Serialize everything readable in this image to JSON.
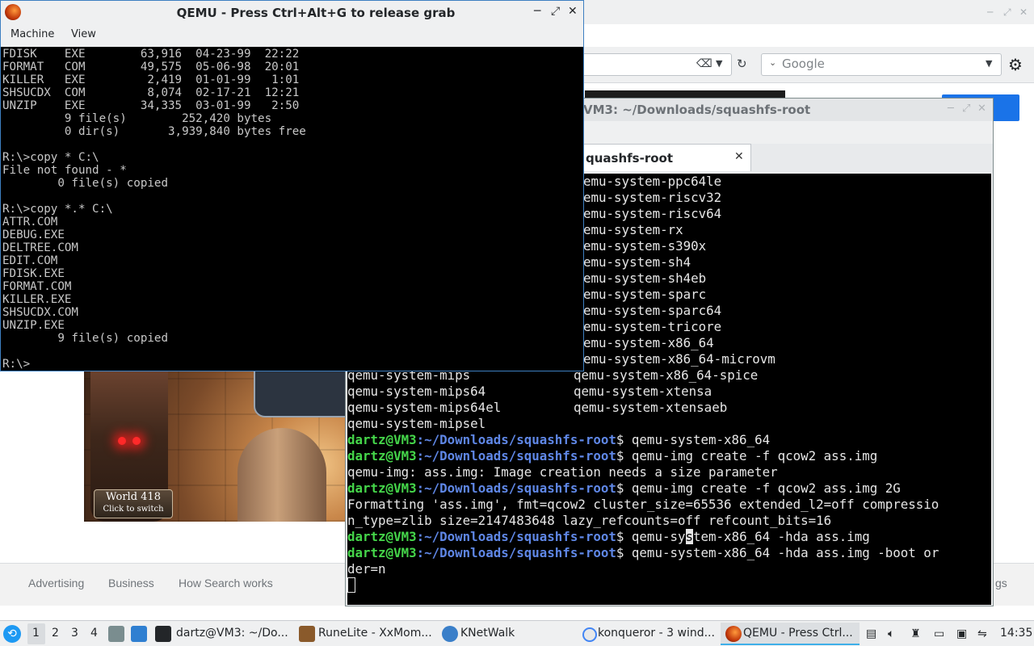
{
  "browser": {
    "search_placeholder": "Google",
    "footer_links": [
      "Advertising",
      "Business",
      "How Search works"
    ],
    "footer_right": "gs"
  },
  "game": {
    "world_title": "World 418",
    "world_sub": "Click to switch"
  },
  "konsole": {
    "title": "VM3: ~/Downloads/squashfs-root",
    "tab_label": "quashfs-root",
    "terminal_lines": [
      "emu-system-ppc64le",
      "emu-system-riscv32",
      "emu-system-riscv64",
      "emu-system-rx",
      "emu-system-s390x",
      "emu-system-sh4",
      "emu-system-sh4eb",
      "emu-system-sparc",
      "emu-system-sparc64",
      "emu-system-tricore",
      "emu-system-x86_64",
      "emu-system-x86_64-microvm"
    ],
    "terminal_columns": [
      [
        "qemu-system-mips",
        "qemu-system-x86_64-spice"
      ],
      [
        "qemu-system-mips64",
        "qemu-system-xtensa"
      ],
      [
        "qemu-system-mips64el",
        "qemu-system-xtensaeb"
      ],
      [
        "qemu-system-mipsel",
        ""
      ]
    ],
    "prompt_user": "dartz@VM3",
    "prompt_path": ":~/Downloads/squashfs-root",
    "commands": [
      "$ qemu-system-x86_64",
      "$ qemu-img create -f qcow2 ass.img"
    ],
    "output_1": "qemu-img: ass.img: Image creation needs a size parameter",
    "command_3": "$ qemu-img create -f qcow2 ass.img 2G",
    "output_2": "Formatting 'ass.img', fmt=qcow2 cluster_size=65536 extended_l2=off compressio",
    "output_3": "n_type=zlib size=2147483648 lazy_refcounts=off refcount_bits=16",
    "command_4_pre": "$ qemu-sy",
    "command_4_cursor": "s",
    "command_4_post": "tem-x86_64 -hda ass.img",
    "command_5": "$ qemu-system-x86_64 -hda ass.img -boot or",
    "command_5_wrap": "der=n"
  },
  "qemu": {
    "title": "QEMU - Press Ctrl+Alt+G to release grab",
    "menu": [
      "Machine",
      "View"
    ],
    "dos_lines": [
      "FDISK    EXE        63,916  04-23-99  22:22",
      "FORMAT   COM        49,575  05-06-98  20:01",
      "KILLER   EXE         2,419  01-01-99   1:01",
      "SHSUCDX  COM         8,074  02-17-21  12:21",
      "UNZIP    EXE        34,335  03-01-99   2:50",
      "         9 file(s)        252,420 bytes",
      "         0 dir(s)       3,939,840 bytes free",
      "",
      "R:\\>copy * C:\\",
      "File not found - *",
      "        0 file(s) copied",
      "",
      "R:\\>copy *.* C:\\",
      "ATTR.COM",
      "DEBUG.EXE",
      "DELTREE.COM",
      "EDIT.COM",
      "FDISK.EXE",
      "FORMAT.COM",
      "KILLER.EXE",
      "SHSUCDX.COM",
      "UNZIP.EXE",
      "        9 file(s) copied",
      "",
      "R:\\>"
    ]
  },
  "taskbar": {
    "workspaces": [
      "1",
      "2",
      "3",
      "4"
    ],
    "tasks": [
      "dartz@VM3: ~/Do...",
      "RuneLite - XxMom...",
      "KNetWalk",
      "konqueror - 3 wind...",
      "QEMU - Press Ctrl..."
    ],
    "clock": "14:35"
  }
}
